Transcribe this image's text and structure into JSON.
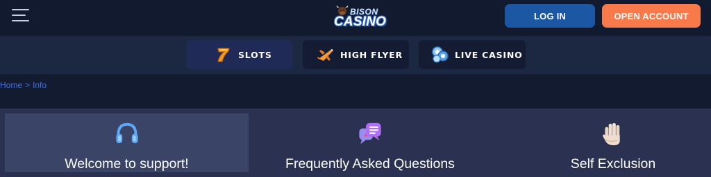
{
  "header": {
    "menu_icon": "hamburger-icon",
    "logo": {
      "line1": "BISON",
      "line2": "CASINO"
    },
    "login_label": "LOG IN",
    "open_account_label": "OPEN ACCOUNT",
    "colors": {
      "login": "#1c57a3",
      "open_account": "#f8794a"
    }
  },
  "nav": {
    "items": [
      {
        "label": "SLOTS",
        "icon": "seven-icon"
      },
      {
        "label": "HIGH FLYER",
        "icon": "airplane-icon"
      },
      {
        "label": "LIVE CASINO",
        "icon": "chips-icon"
      }
    ]
  },
  "breadcrumb": {
    "home": "Home",
    "separator": ">",
    "current": "Info"
  },
  "tabs": [
    {
      "label": "Welcome to support!",
      "icon": "headphones-icon",
      "active": true
    },
    {
      "label": "Frequently Asked Questions",
      "icon": "chat-bubbles-icon",
      "active": false
    },
    {
      "label": "Self Exclusion",
      "icon": "raised-hand-icon",
      "active": false
    }
  ]
}
